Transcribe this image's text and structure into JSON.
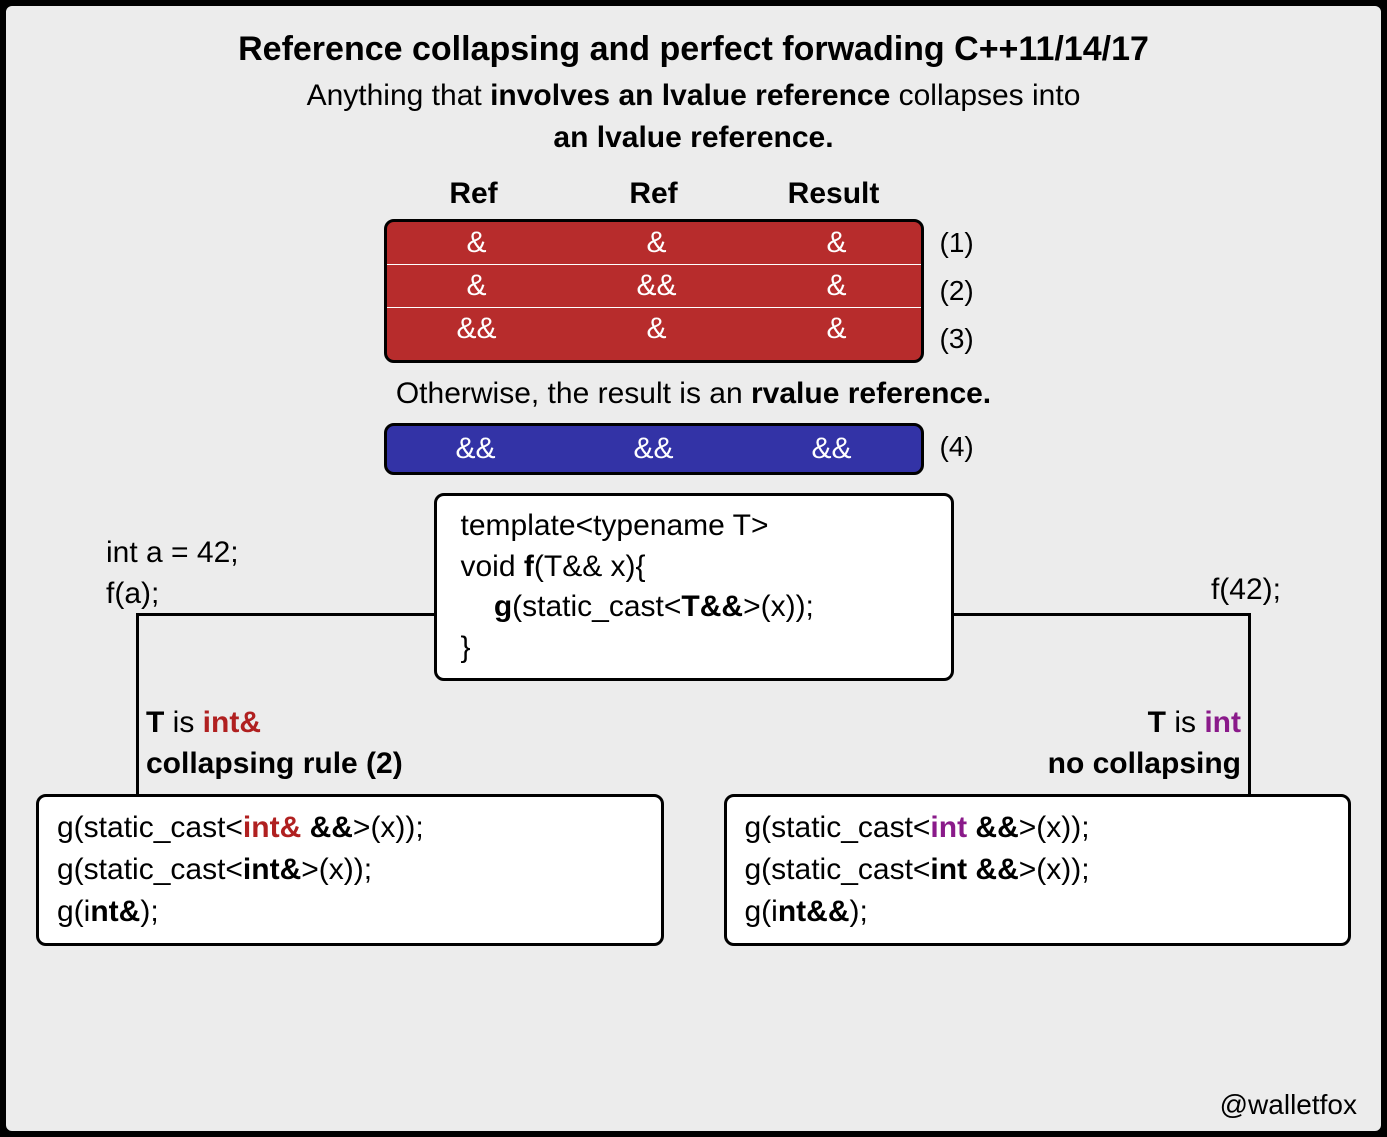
{
  "title": "Reference collapsing and perfect forwading C++11/14/17",
  "subtitle": {
    "pre": "Anything that ",
    "bold1": "involves an lvalue reference",
    "mid": " collapses into",
    "bold2": "an lvalue reference."
  },
  "headers": {
    "c1": "Ref",
    "c2": "Ref",
    "c3": "Result"
  },
  "red_rows": [
    {
      "a": "&",
      "b": "&",
      "r": "&",
      "n": "(1)"
    },
    {
      "a": "&",
      "b": "&&",
      "r": "&",
      "n": "(2)"
    },
    {
      "a": "&&",
      "b": "&",
      "r": "&",
      "n": "(3)"
    }
  ],
  "otherwise": {
    "pre": "Otherwise, the result is an ",
    "bold": "rvalue reference."
  },
  "blue_row": {
    "a": "&&",
    "b": "&&",
    "r": "&&",
    "n": "(4)"
  },
  "template_code": {
    "l1": "template<typename T>",
    "l2a": "void ",
    "l2b": "f",
    "l2c": "(T&& x){",
    "l3a": "    ",
    "l3b": "g",
    "l3c": "(static_cast<",
    "l3d": "T&&",
    "l3e": ">(x));",
    "l4": "}"
  },
  "left_call": {
    "l1": "int a = 42;",
    "l2": "f(a);"
  },
  "right_call": "f(42);",
  "branch_left": {
    "t": "T",
    "is": " is ",
    "type": "int&",
    "rule": "collapsing rule (2)"
  },
  "branch_right": {
    "t": "T",
    "is": " is ",
    "type": "int",
    "rule": "no collapsing"
  },
  "result_left": {
    "l1a": "g(static_cast<",
    "l1b": "int&",
    "l1c": " &&",
    "l1d": ">(x));",
    "l2a": "g(static_cast<",
    "l2b": "int&",
    "l2c": ">(x));",
    "l3a": "g(i",
    "l3b": "nt&",
    "l3c": ");"
  },
  "result_right": {
    "l1a": "g(static_cast<",
    "l1b": "int",
    "l1c": " &&",
    "l1d": ">(x));",
    "l2a": "g(static_cast<",
    "l2b": "int &&",
    "l2c": ">(x));",
    "l3a": "g(i",
    "l3b": "nt&&",
    "l3c": ");"
  },
  "credit": "@walletfox"
}
